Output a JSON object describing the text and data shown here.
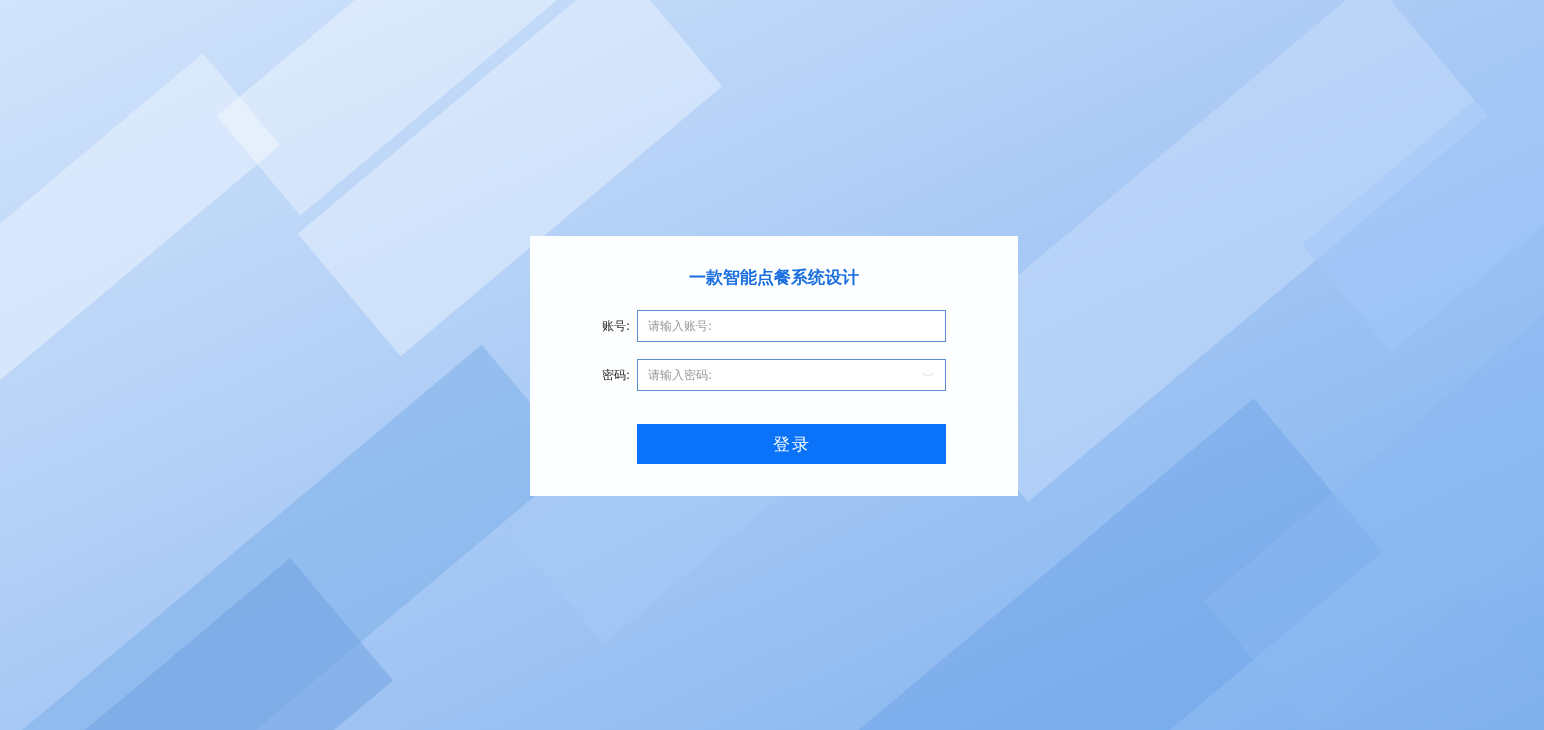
{
  "login": {
    "title": "一款智能点餐系统设计",
    "fields": [
      {
        "kind": "text",
        "label": "账号:",
        "placeholder": "请输入账号:"
      },
      {
        "kind": "password",
        "label": "密码:",
        "placeholder": "请输入密码:"
      }
    ],
    "submit": "登录"
  }
}
